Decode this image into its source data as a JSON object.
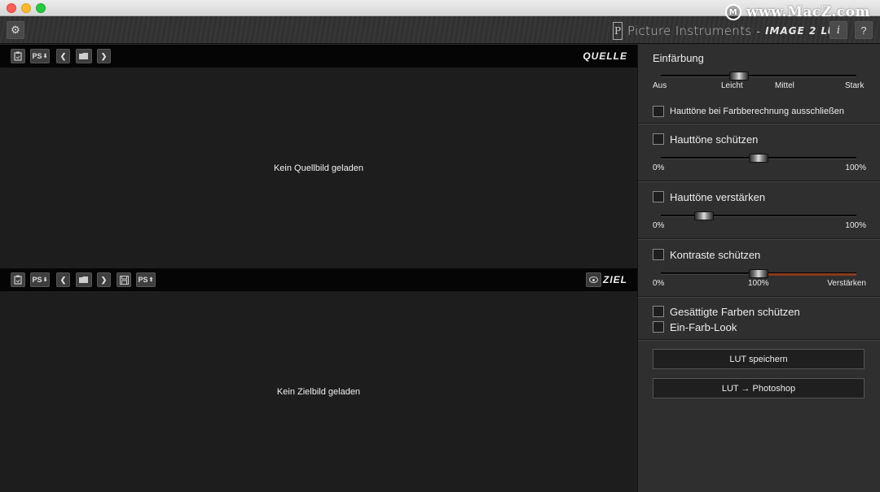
{
  "watermark": {
    "logo": "M",
    "text": "www.MacZ.com"
  },
  "header": {
    "brand_name": "Picture Instruments",
    "brand_dash": "-",
    "product": "IMAGE 2 LUT",
    "info_label": "i",
    "help_label": "?",
    "settings_icon": "gear-icon"
  },
  "source": {
    "title": "QUELLE",
    "empty_message": "Kein Quellbild geladen",
    "ps_label": "PS",
    "ps_arrow": "⬇",
    "prev": "❮",
    "next": "❯"
  },
  "target": {
    "title": "ZIEL",
    "empty_message": "Kein Zielbild geladen",
    "ps_label": "PS",
    "ps_arrow": "⬇",
    "ps_export_label": "PS",
    "ps_export_arrow": "⬆",
    "prev": "❮",
    "next": "❯"
  },
  "panel": {
    "coloring": {
      "title": "Einfärbung",
      "ticks": [
        "Aus",
        "Leicht",
        "Mittel",
        "Stark"
      ],
      "value": 0.4,
      "checkbox_label": "Hauttöne bei Farbberechnung ausschließen",
      "checked": false
    },
    "protect_skin": {
      "label": "Hauttöne schützen",
      "checked": false,
      "min_label": "0%",
      "max_label": "100%",
      "value": 0.5
    },
    "enhance_skin": {
      "label": "Hauttöne verstärken",
      "checked": false,
      "min_label": "0%",
      "max_label": "100%",
      "value": 0.22
    },
    "protect_contrast": {
      "label": "Kontraste schützen",
      "checked": false,
      "min_label": "0%",
      "mid_label": "100%",
      "max_label": "Verstärken",
      "value": 0.5,
      "accent_color": "#8a3b1e"
    },
    "options": {
      "saturated_label": "Gesättigte Farben schützen",
      "saturated_checked": false,
      "monochrome_label": "Ein-Farb-Look",
      "monochrome_checked": false
    },
    "save_lut_label": "LUT speichern",
    "lut_photoshop_label": "LUT → Photoshop"
  }
}
